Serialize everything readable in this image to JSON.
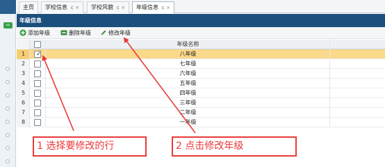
{
  "tabs": [
    {
      "label": "主页"
    },
    {
      "label": "学校信息",
      "close": "¢ ×"
    },
    {
      "label": "学校风貌",
      "close": "¢ ×"
    },
    {
      "label": "年级信息",
      "close": "¢ ×"
    }
  ],
  "panel": {
    "title": "年级信息"
  },
  "toolbar": {
    "add_label": "添加年级",
    "delete_label": "删除年级",
    "edit_label": "修改年级"
  },
  "grid": {
    "column_header": "年级名称",
    "rows": [
      {
        "num": "1",
        "name": "八年级",
        "checked": true
      },
      {
        "num": "2",
        "name": "七年级",
        "checked": false
      },
      {
        "num": "3",
        "name": "六年级",
        "checked": false
      },
      {
        "num": "4",
        "name": "五年级",
        "checked": false
      },
      {
        "num": "5",
        "name": "四年级",
        "checked": false
      },
      {
        "num": "6",
        "name": "三年级",
        "checked": false
      },
      {
        "num": "7",
        "name": "二年级",
        "checked": false
      },
      {
        "num": "8",
        "name": "一年级",
        "checked": false
      }
    ]
  },
  "callouts": {
    "step1": "1 选择要修改的行",
    "step2": "2 点击修改年级"
  },
  "colors": {
    "accent": "#1d4f7d",
    "selected_row": "#fbd98a",
    "annotation": "#e83a3a"
  },
  "icons": {
    "add": "plus-circle-icon",
    "delete": "minus-rect-icon",
    "edit": "pencil-icon"
  }
}
